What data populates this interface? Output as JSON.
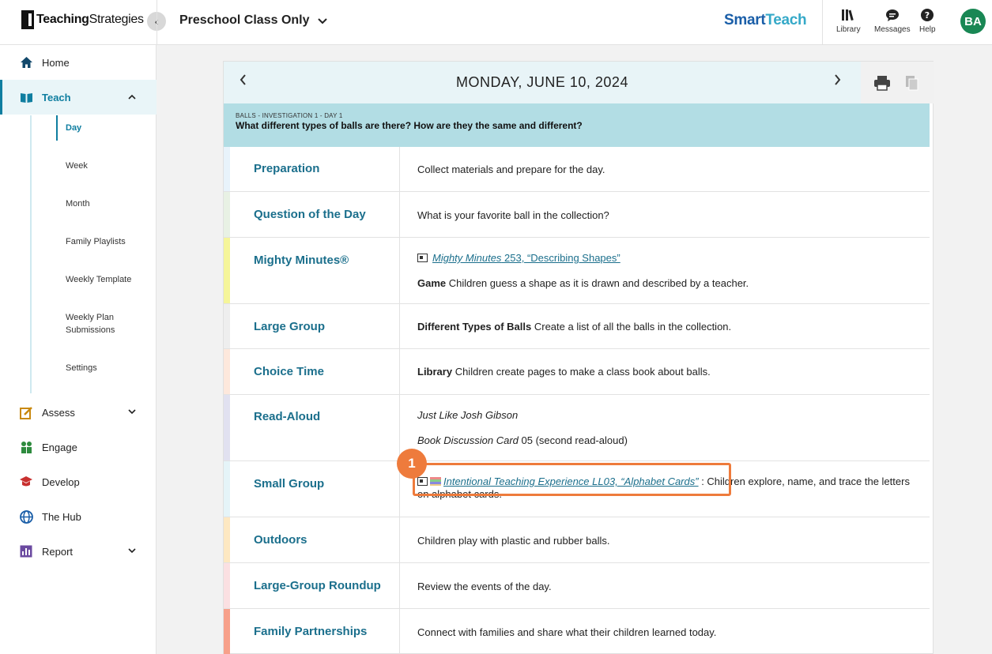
{
  "header": {
    "logo_bold": "Teaching",
    "logo_rest": "Strategies",
    "class_name": "Preschool Class Only",
    "brand_a": "Smart",
    "brand_b": "Teach",
    "tools": [
      {
        "label": "Library",
        "icon": "library-icon"
      },
      {
        "label": "Messages",
        "icon": "messages-icon"
      },
      {
        "label": "Help",
        "icon": "help-icon"
      }
    ],
    "avatar_initials": "BA"
  },
  "sidebar": {
    "items": [
      {
        "label": "Home",
        "icon": "home-icon"
      },
      {
        "label": "Teach",
        "icon": "book-icon"
      },
      {
        "label": "Assess",
        "icon": "assess-icon"
      },
      {
        "label": "Engage",
        "icon": "engage-icon"
      },
      {
        "label": "Develop",
        "icon": "graduation-cap-icon"
      },
      {
        "label": "The Hub",
        "icon": "globe-icon"
      },
      {
        "label": "Report",
        "icon": "bar-chart-icon"
      }
    ],
    "teach_sub": [
      "Day",
      "Week",
      "Month",
      "Family Playlists",
      "Weekly Template",
      "Weekly Plan Submissions",
      "Settings"
    ]
  },
  "day": {
    "date": "MONDAY, JUNE 10, 2024",
    "investigation_label": "BALLS - INVESTIGATION 1 - DAY 1",
    "investigation_question": "What different types of balls are there? How are they the same and different?"
  },
  "rows": [
    {
      "label": "Preparation",
      "text": "Collect materials and prepare for the day.",
      "stripe": "#e8f3fb"
    },
    {
      "label": "Question of the Day",
      "text": "What is your favorite ball in the collection?",
      "stripe": "#e8f1e4"
    },
    {
      "label": "Mighty Minutes®",
      "link": "Mighty Minutes",
      "link_rest": " 253, “Describing Shapes”",
      "bold": "Game",
      "text": " Children guess a shape as it is drawn and described by a teacher.",
      "stripe": "#f5f59a"
    },
    {
      "label": "Large Group",
      "bold": "Different Types of Balls",
      "text": " Create a list of all the balls in the collection.",
      "stripe": "#eeeeee"
    },
    {
      "label": "Choice Time",
      "bold": "Library",
      "text": " Children create pages to make a class book about balls.",
      "stripe": "#fde8dc"
    },
    {
      "label": "Read-Aloud",
      "italic1": "Just Like Josh Gibson",
      "italic2": "Book Discussion Card",
      "text2": " 05 (second read-aloud)",
      "stripe": "#e1e1f0"
    },
    {
      "label": "Small Group",
      "link": "Intentional Teaching Experience",
      "link_rest": " LL03, “Alphabet Cards”",
      "text": " : Children explore, name, and trace the letters on alphabet cards.",
      "stripe": "#e5f4f8"
    },
    {
      "label": "Outdoors",
      "text": "Children play with plastic and rubber balls.",
      "stripe": "#fde8c2"
    },
    {
      "label": "Large-Group Roundup",
      "text": "Review the events of the day.",
      "stripe": "#fbe0e2"
    },
    {
      "label": "Family Partnerships",
      "text": "Connect with families and share what their children learned today.",
      "stripe": "#f7a08a"
    }
  ],
  "callout": {
    "number": "1",
    "color": "#ee7b3c"
  }
}
